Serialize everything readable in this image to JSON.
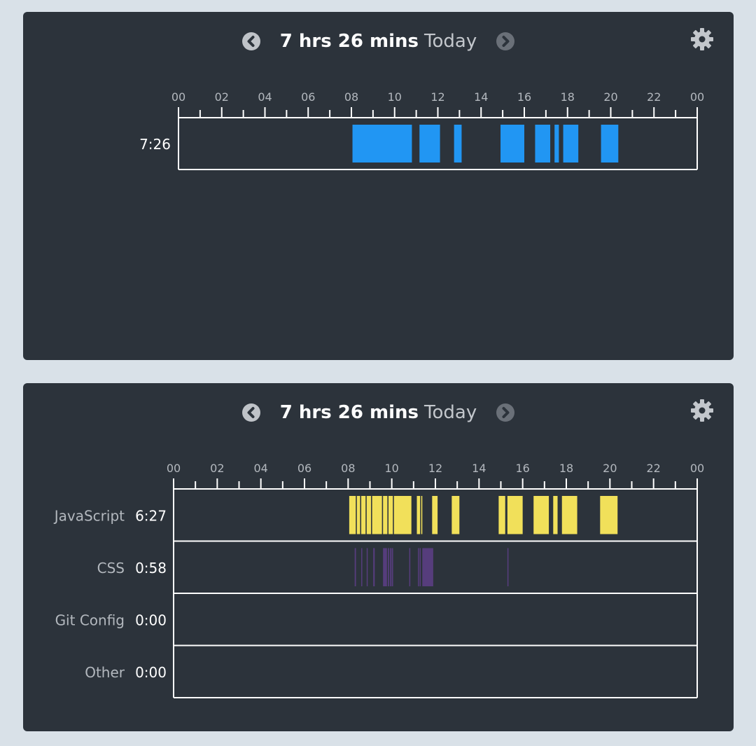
{
  "panels": [
    {
      "title_total": "7 hrs 26 mins",
      "title_range": "Today",
      "colors": {
        "bar": "#2196f3"
      },
      "chart_data": {
        "type": "timeline",
        "x_ticks": [
          "00",
          "02",
          "04",
          "06",
          "08",
          "10",
          "12",
          "14",
          "16",
          "18",
          "20",
          "22",
          "00"
        ],
        "xlim": [
          0,
          24
        ],
        "rows": [
          {
            "label": "",
            "time": "7:26",
            "color": "#2196f3",
            "segments": [
              [
                8.05,
                10.8
              ],
              [
                11.15,
                12.1
              ],
              [
                12.75,
                13.1
              ],
              [
                14.9,
                16.0
              ],
              [
                16.5,
                17.2
              ],
              [
                17.4,
                17.6
              ],
              [
                17.8,
                18.5
              ],
              [
                19.55,
                20.35
              ]
            ]
          }
        ]
      }
    },
    {
      "title_total": "7 hrs 26 mins",
      "title_range": "Today",
      "colors": {
        "javascript": "#f1e05a",
        "css": "#563d7c"
      },
      "chart_data": {
        "type": "timeline",
        "x_ticks": [
          "00",
          "02",
          "04",
          "06",
          "08",
          "10",
          "12",
          "14",
          "16",
          "18",
          "20",
          "22",
          "00"
        ],
        "xlim": [
          0,
          24
        ],
        "rows": [
          {
            "label": "JavaScript",
            "time": "6:27",
            "color": "#f1e05a",
            "segments": [
              [
                8.05,
                8.35
              ],
              [
                8.4,
                8.55
              ],
              [
                8.6,
                8.8
              ],
              [
                8.85,
                9.05
              ],
              [
                9.1,
                9.55
              ],
              [
                9.6,
                9.8
              ],
              [
                9.85,
                10.05
              ],
              [
                10.1,
                10.9
              ],
              [
                11.15,
                11.3
              ],
              [
                11.35,
                11.4
              ],
              [
                11.85,
                12.1
              ],
              [
                12.75,
                13.1
              ],
              [
                14.9,
                15.2
              ],
              [
                15.3,
                16.0
              ],
              [
                16.5,
                17.2
              ],
              [
                17.4,
                17.6
              ],
              [
                17.8,
                18.5
              ],
              [
                19.55,
                20.35
              ]
            ]
          },
          {
            "label": "CSS",
            "time": "0:58",
            "color": "#563d7c",
            "segments": [
              [
                8.3,
                8.36
              ],
              [
                8.6,
                8.64
              ],
              [
                8.85,
                8.89
              ],
              [
                9.15,
                9.22
              ],
              [
                9.6,
                9.78
              ],
              [
                9.82,
                9.88
              ],
              [
                9.92,
                9.98
              ],
              [
                10.0,
                10.06
              ],
              [
                10.8,
                10.85
              ],
              [
                11.2,
                11.24
              ],
              [
                11.28,
                11.32
              ],
              [
                11.4,
                11.9
              ],
              [
                15.3,
                15.35
              ]
            ]
          },
          {
            "label": "Git Config",
            "time": "0:00",
            "color": "#f1e05a",
            "segments": []
          },
          {
            "label": "Other",
            "time": "0:00",
            "color": "#8a8a8a",
            "segments": []
          }
        ]
      }
    }
  ]
}
